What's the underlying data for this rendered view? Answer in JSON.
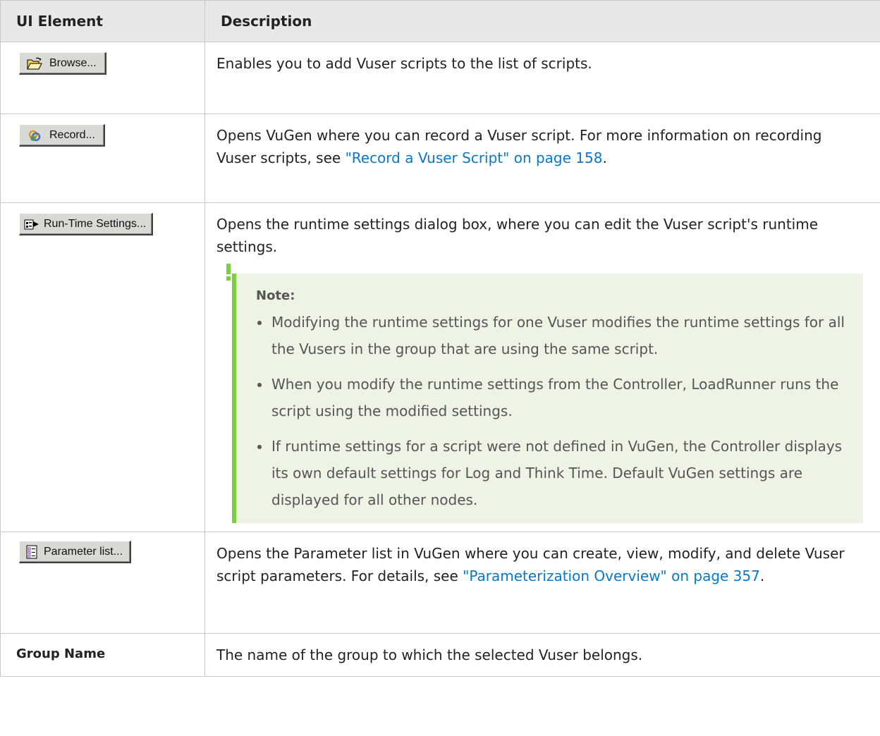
{
  "headers": {
    "ui_element": "UI Element",
    "description": "Description"
  },
  "rows": {
    "browse": {
      "button_label": "Browse...",
      "icon": "open-folder-icon",
      "description": "Enables you to add Vuser scripts to the list of scripts."
    },
    "record": {
      "button_label": "Record...",
      "icon": "record-icon",
      "description_pre": "Opens VuGen where you can record a Vuser script. For more information on recording Vuser scripts, see ",
      "link": "\"Record a Vuser Script\" on page 158",
      "description_post": "."
    },
    "runtime": {
      "button_label": "Run-Time Settings...",
      "icon": "runtime-settings-icon",
      "description": "Opens the runtime settings dialog box, where you can edit the Vuser script's runtime settings.",
      "note": {
        "title": "Note:",
        "items": [
          "Modifying the runtime settings for one Vuser modifies the runtime settings for all the Vusers in the group that are using the same script.",
          "When you modify the runtime settings from the Controller, LoadRunner runs the script using the modified settings.",
          "If runtime settings for a script were not defined in VuGen, the Controller displays its own default settings for Log and Think Time. Default VuGen settings are displayed for all other nodes."
        ]
      }
    },
    "parameter": {
      "button_label": "Parameter list...",
      "icon": "parameter-list-icon",
      "description_pre": "Opens the Parameter list in VuGen where you can create, view, modify, and delete Vuser script parameters. For details, see ",
      "link": "\"Parameterization Overview\" on page 357",
      "description_post": "."
    },
    "group_name": {
      "label": "Group Name",
      "description": "The name of the group to which the selected Vuser belongs."
    }
  },
  "colors": {
    "link": "#0b77c9",
    "note_bar": "#7bd03f",
    "note_bg": "#eef3e6",
    "header_bg": "#e8e8e8"
  }
}
